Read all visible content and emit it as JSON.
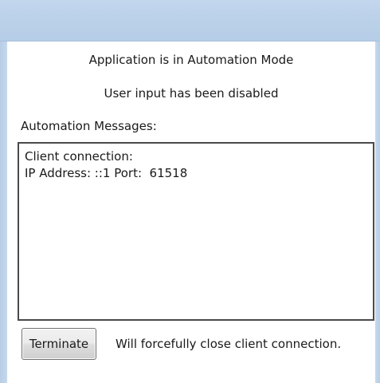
{
  "status": {
    "line1": "Application is in Automation Mode",
    "line2": "User input has been disabled"
  },
  "messages": {
    "label": "Automation Messages:",
    "lines": [
      "Client connection:",
      "IP Address: ::1 Port:  61518"
    ]
  },
  "footer": {
    "terminate_label": "Terminate",
    "note": "Will forcefully close client connection."
  }
}
